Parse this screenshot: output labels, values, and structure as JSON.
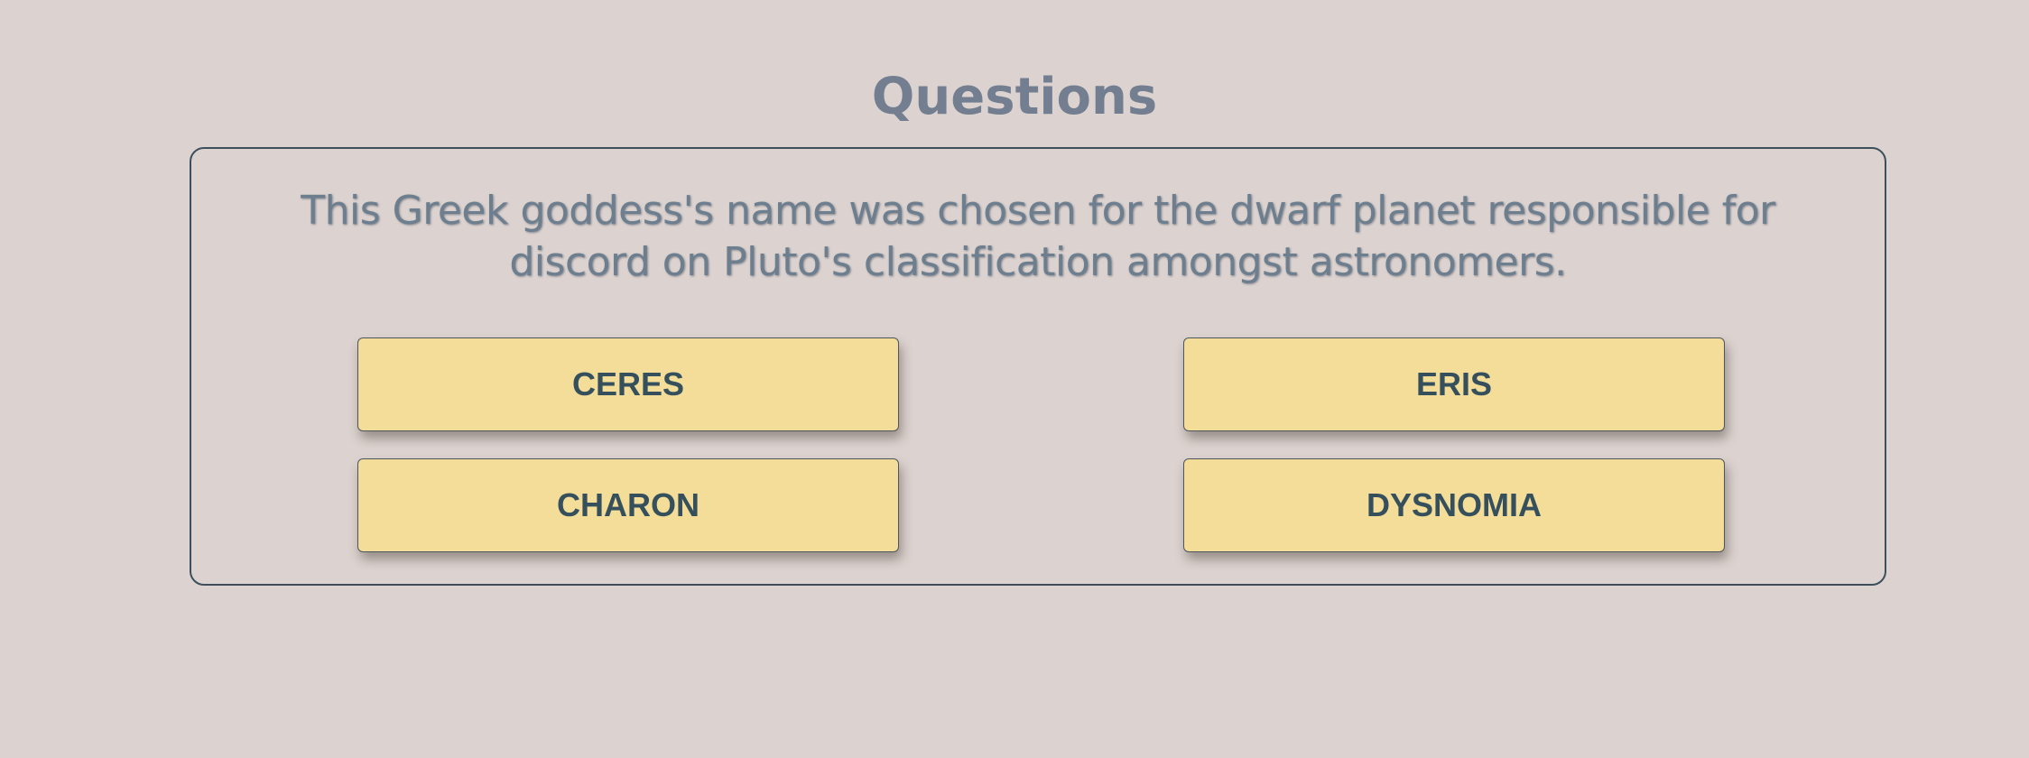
{
  "page": {
    "heading": "Questions"
  },
  "quiz": {
    "question": "This Greek goddess's name was chosen for the dwarf planet responsible for discord on Pluto's classification amongst astronomers.",
    "answers": [
      "CERES",
      "ERIS",
      "CHARON",
      "DYSNOMIA"
    ]
  },
  "colors": {
    "background": "#dcd3d0",
    "heading": "#737f91",
    "question_text": "#6d7e8f",
    "card_border": "#3d4f5c",
    "answer_bg": "#f4dd98",
    "answer_text": "#35505c"
  }
}
